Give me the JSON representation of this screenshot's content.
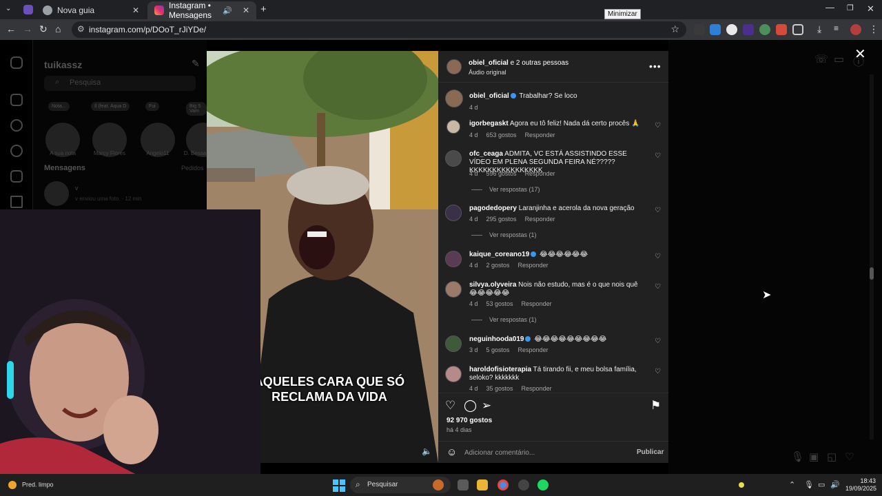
{
  "browser": {
    "tabs": [
      {
        "label": "Nova guia",
        "active": false
      },
      {
        "label": "Instagram • Mensagens",
        "active": true
      }
    ],
    "url": "instagram.com/p/DOoT_rJiYDe/",
    "tooltip": "Minimizar"
  },
  "instagram": {
    "username": "tuikassz",
    "search_placeholder": "Pesquisa",
    "notes": [
      {
        "name": "A sua nota",
        "bubble": "Nota..."
      },
      {
        "name": "Marcy Flores",
        "bubble": "Il (feat. Aqua D"
      },
      {
        "name": "Angelo11",
        "bubble": "Fui"
      },
      {
        "name": "D. Bessa",
        "bubble": "Big S Vam"
      }
    ],
    "messages_label": "Mensagens",
    "requests_label": "Pedidos",
    "dm_row": {
      "name": "v",
      "preview": "v enviou uma foto. · 12 min"
    }
  },
  "post": {
    "author": "obiel_oficial",
    "coauthors": "e 2 outras pessoas",
    "audio": "Áudio original",
    "caption_overlay": "AQUELES CARA QUE SÓ RECLAMA DA VIDA",
    "likes": "92 970 gostos",
    "time_ago": "há 4 dias",
    "comment_placeholder": "Adicionar comentário...",
    "publish_label": "Publicar",
    "comments": [
      {
        "user": "obiel_oficial",
        "verified": true,
        "text": "Trabalhar? Se loco",
        "time": "4 d",
        "likes": "",
        "reply": "",
        "replies": ""
      },
      {
        "user": "igorbegaskt",
        "verified": false,
        "text": "Agora eu tô feliz! Nada dá certo procês 🙏",
        "time": "4 d",
        "likes": "653 gostos",
        "reply": "Responder",
        "replies": ""
      },
      {
        "user": "ofc_ceaga",
        "verified": false,
        "text": "ADMITA, VC ESTÁ ASSISTINDO ESSE VÍDEO EM PLENA SEGUNDA FEIRA NÉ?????KKKKKKKKKKKKKKKK",
        "time": "4 d",
        "likes": "596 gostos",
        "reply": "Responder",
        "replies": "Ver respostas (17)"
      },
      {
        "user": "pagodedopery",
        "verified": false,
        "text": "Laranjinha e acerola da nova geração",
        "time": "4 d",
        "likes": "295 gostos",
        "reply": "Responder",
        "replies": "Ver respostas (1)"
      },
      {
        "user": "kaique_coreano19",
        "verified": true,
        "text": "😂😂😂😂😂😂",
        "time": "4 d",
        "likes": "2 gostos",
        "reply": "Responder",
        "replies": ""
      },
      {
        "user": "silvya.olyveira",
        "verified": false,
        "text": "Nois não estudo, mas é o que nois quê 😂😂😂😂😂",
        "time": "4 d",
        "likes": "53 gostos",
        "reply": "Responder",
        "replies": "Ver respostas (1)"
      },
      {
        "user": "neguinhooda019",
        "verified": true,
        "text": "😂😂😂😂😂😂😂😂😂",
        "time": "3 d",
        "likes": "5 gostos",
        "reply": "Responder",
        "replies": ""
      },
      {
        "user": "haroldofisioterapia",
        "verified": false,
        "text": "Tá tirando fii, e meu bolsa família, seloko? kkkkkkk",
        "time": "4 d",
        "likes": "35 gostos",
        "reply": "Responder",
        "replies": ""
      }
    ]
  },
  "taskbar": {
    "weather": "Pred. limpo",
    "search_label": "Pesquisar",
    "time": "18:43",
    "date": "19/09/2025"
  },
  "colors": {
    "accent": "#3897f0",
    "panel": "#212121",
    "windows_blue": "#4cc2ff"
  }
}
